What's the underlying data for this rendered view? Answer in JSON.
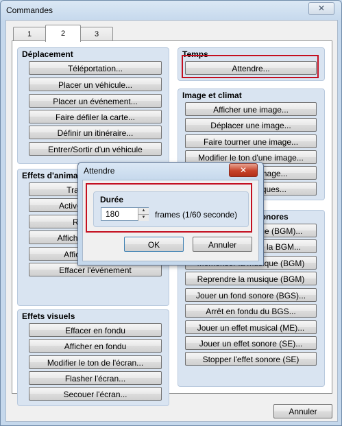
{
  "window": {
    "title": "Commandes",
    "close_glyph": "✕"
  },
  "tabs": [
    "1",
    "2",
    "3"
  ],
  "groups": {
    "deplacement": {
      "title": "Déplacement",
      "buttons": [
        "Téléportation...",
        "Placer un véhicule...",
        "Placer un événement...",
        "Faire défiler la carte...",
        "Définir un itinéraire...",
        "Entrer/Sortir d'un véhicule"
      ]
    },
    "temps": {
      "title": "Temps",
      "buttons": [
        "Attendre..."
      ]
    },
    "image": {
      "title": "Image et climat",
      "buttons": [
        "Afficher une image...",
        "Déplacer une image...",
        "Faire tourner une image...",
        "Modifier le ton d'une image...",
        "Effacer une image...",
        "Effets climatiques..."
      ]
    },
    "animation": {
      "title": "Effets d'animation",
      "buttons": [
        "Transparence...",
        "Activer/Désactiver...",
        "Regrouper...",
        "Afficher l'animation...",
        "Afficher la bulle...",
        "Effacer l'événement"
      ]
    },
    "sonores": {
      "title": "Musiques et effets sonores",
      "buttons": [
        "Jouer une musique (BGM)...",
        "Arrêt en fondu de la BGM...",
        "Mémoriser la musique (BGM)",
        "Reprendre la musique (BGM)",
        "Jouer un fond sonore (BGS)...",
        "Arrêt en fondu du BGS...",
        "Jouer un effet musical (ME)...",
        "Jouer un effet sonore (SE)...",
        "Stopper l'effet sonore (SE)"
      ]
    },
    "visuels": {
      "title": "Effets visuels",
      "buttons": [
        "Effacer en fondu",
        "Afficher en fondu",
        "Modifier le ton de l'écran...",
        "Flasher l'écran...",
        "Secouer l'écran..."
      ]
    }
  },
  "footer": {
    "cancel_label": "Annuler"
  },
  "dialog": {
    "title": "Attendre",
    "close_glyph": "✕",
    "group_title": "Durée",
    "value": "180",
    "unit_label": "frames (1/60 seconde)",
    "ok_label": "OK",
    "cancel_label": "Annuler"
  },
  "colors": {
    "highlight": "#c40f1f",
    "group_bg": "#d9e4f1"
  }
}
